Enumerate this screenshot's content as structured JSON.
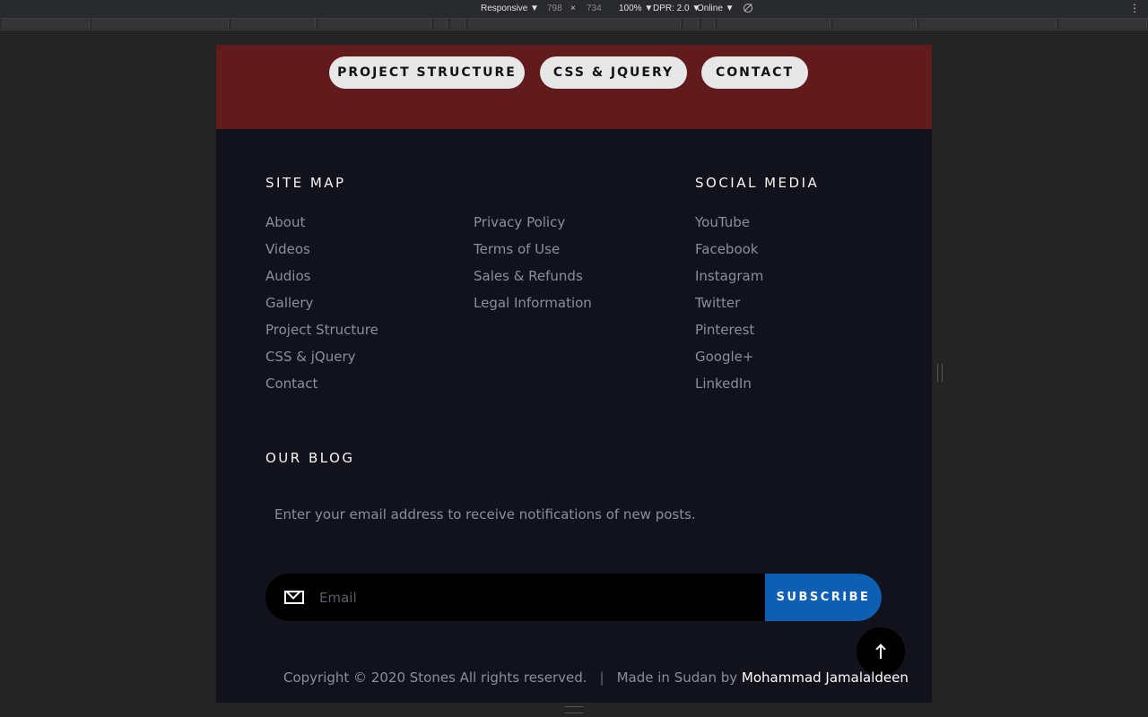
{
  "devtools": {
    "device_mode": "Responsive ▼",
    "width": "798",
    "times": "×",
    "height": "734",
    "zoom": "100% ▼",
    "dpr": "DPR: 2.0 ▼",
    "throttle": "Online ▼",
    "menu_glyph": "⋮"
  },
  "nav": {
    "buttons": [
      "PROJECT STRUCTURE",
      "CSS & JQUERY",
      "CONTACT"
    ]
  },
  "footer": {
    "sitemap_title": "SITE MAP",
    "sitemap_links": [
      "About",
      "Videos",
      "Audios",
      "Gallery",
      "Project Structure",
      "CSS & jQuery",
      "Contact"
    ],
    "legal_links": [
      "Privacy Policy",
      "Terms of Use",
      "Sales & Refunds",
      "Legal Information"
    ],
    "social_title": "SOCIAL MEDIA",
    "social_links": [
      "YouTube",
      "Facebook",
      "Instagram",
      "Twitter",
      "Pinterest",
      "Google+",
      "LinkedIn"
    ],
    "blog_title": "OUR BLOG",
    "blog_description": "Enter your email address to receive notifications of new posts.",
    "email_placeholder": "Email",
    "subscribe_label": "SUBSCRIBE",
    "copyright": "Copyright © 2020 Stones All rights reserved.",
    "separator": "|",
    "made_in": "Made in Sudan by",
    "author": "Mohammad Jamalaldeen"
  },
  "colors": {
    "red_band": "#611b1c",
    "footer_bg": "#12121c",
    "subscribe_blue": "#0d5fb4"
  },
  "icons": [
    "mail-icon",
    "arrow-up-icon",
    "rotate-icon",
    "more-vert-icon"
  ]
}
